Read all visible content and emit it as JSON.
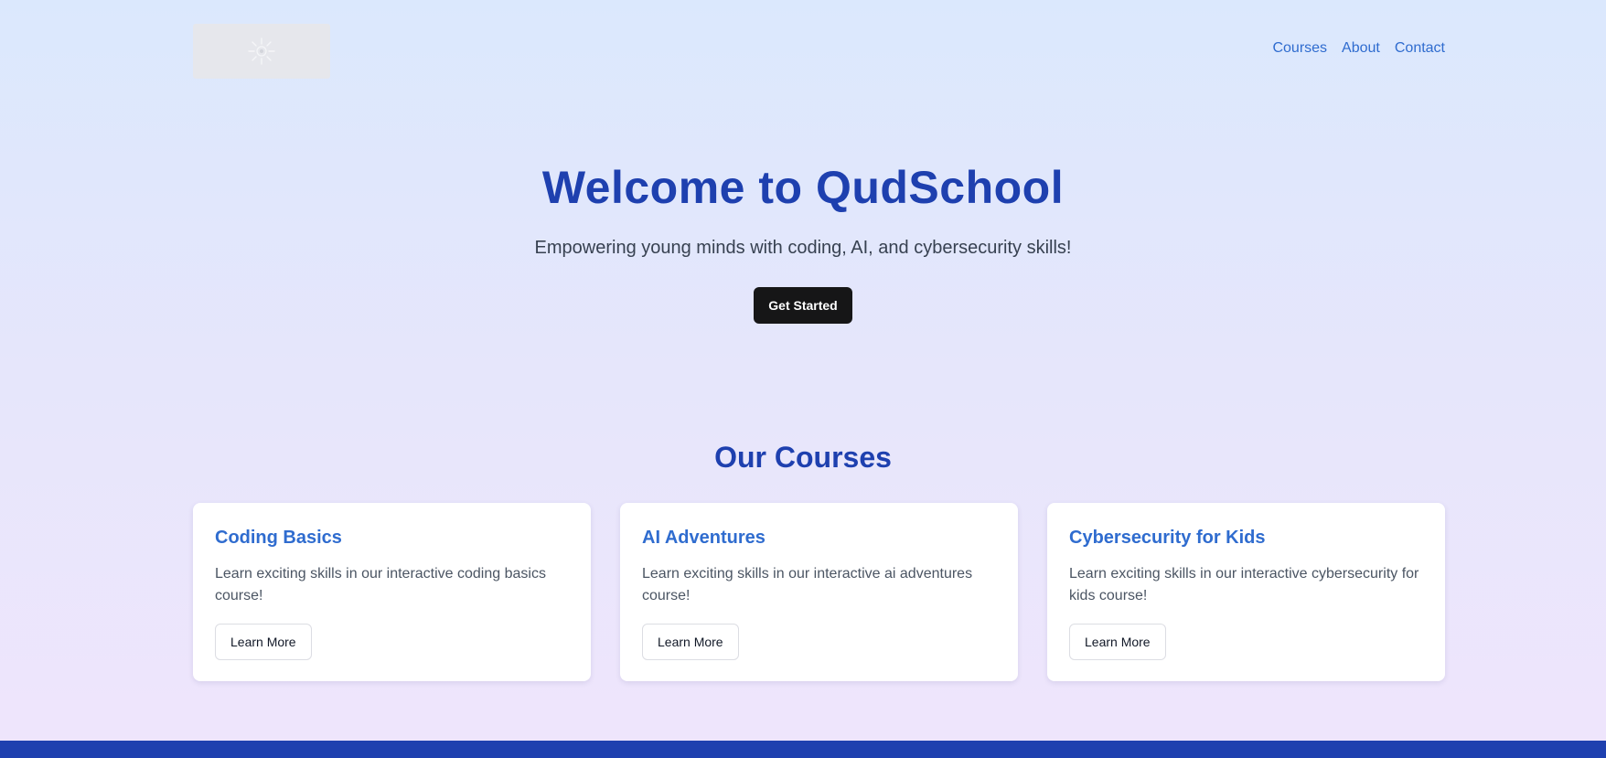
{
  "header": {
    "logo_icon": "sunburst-logo",
    "nav": [
      {
        "label": "Courses"
      },
      {
        "label": "About"
      },
      {
        "label": "Contact"
      }
    ]
  },
  "hero": {
    "title": "Welcome to QudSchool",
    "subtitle": "Empowering young minds with coding, AI, and cybersecurity skills!",
    "cta_label": "Get Started"
  },
  "courses": {
    "title": "Our Courses",
    "items": [
      {
        "title": "Coding Basics",
        "description": "Learn exciting skills in our interactive coding basics course!",
        "button_label": "Learn More"
      },
      {
        "title": "AI Adventures",
        "description": "Learn exciting skills in our interactive ai adventures course!",
        "button_label": "Learn More"
      },
      {
        "title": "Cybersecurity for Kids",
        "description": "Learn exciting skills in our interactive cybersecurity for kids course!",
        "button_label": "Learn More"
      }
    ]
  },
  "colors": {
    "primary": "#1e40af",
    "link": "#2f6ccf",
    "cta_bg": "#161617",
    "footer_bg": "#1e40af"
  }
}
